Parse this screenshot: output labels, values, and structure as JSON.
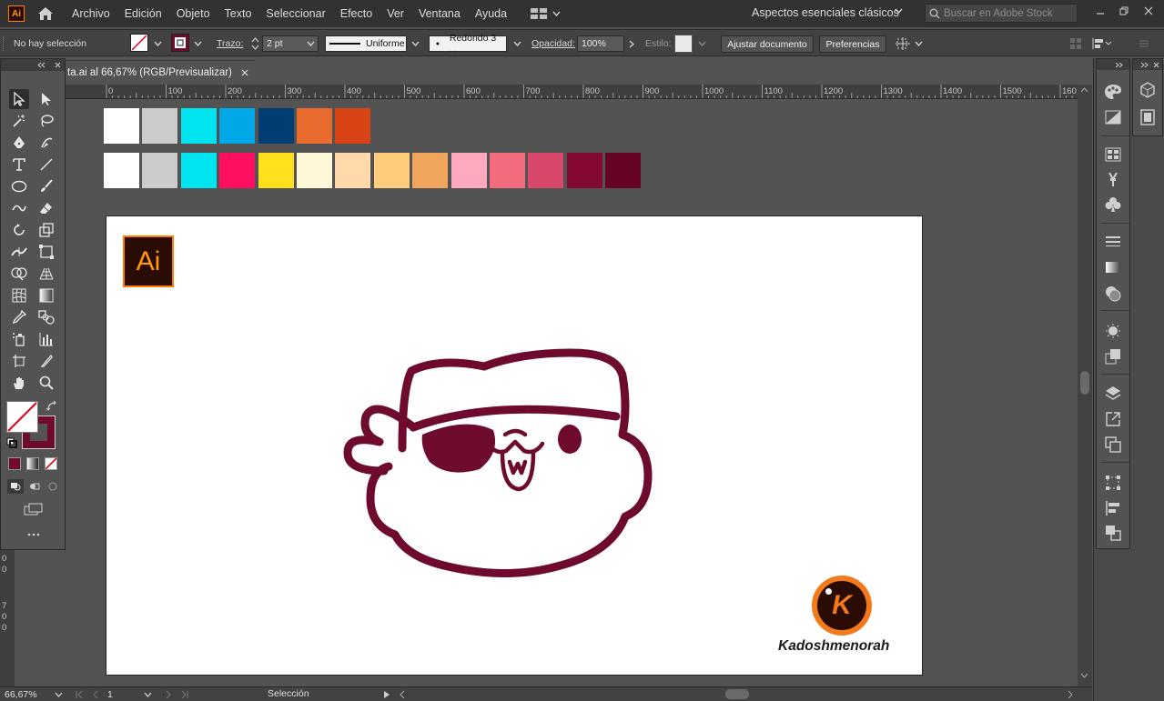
{
  "app": {
    "badge": "Ai"
  },
  "menu": {
    "items": [
      "Archivo",
      "Edición",
      "Objeto",
      "Texto",
      "Seleccionar",
      "Efecto",
      "Ver",
      "Ventana",
      "Ayuda"
    ],
    "workspace": "Aspectos esenciales clásicos",
    "stock_search_placeholder": "Buscar en Adobe Stock"
  },
  "control": {
    "selection_status": "No hay selección",
    "stroke_label": "Trazo:",
    "stroke_weight": "2 pt",
    "stroke_profile": "Uniforme",
    "brush": "Redondo 3 ...",
    "opacity_label": "Opacidad:",
    "opacity_value": "100%",
    "style_label": "Estilo:",
    "fit_document_button": "Ajustar documento",
    "preferences_button": "Preferencias"
  },
  "document": {
    "tab_title": "ta.ai al 66,67% (RGB/Previsualizar)",
    "ruler_labels": [
      "0",
      "100",
      "200",
      "300",
      "400",
      "500",
      "600",
      "700",
      "800",
      "900",
      "1000",
      "1100",
      "1200",
      "1300",
      "1400",
      "1500",
      "160"
    ],
    "vertical_ruler_labels": [
      "0",
      "0",
      "7",
      "0",
      "0"
    ]
  },
  "status": {
    "zoom": "66,67%",
    "artboard_number": "1",
    "tool_name": "Selección"
  },
  "swatches": {
    "row1": [
      "#ffffff",
      "#cccccc",
      "#00e5ef",
      "#00a8e8",
      "#003d73",
      "#ea6b2e",
      "#d84315"
    ],
    "row2": [
      "#ffffff",
      "#cccccc",
      "#00e5ef",
      "#ff0f5f",
      "#ffe01c",
      "#fff8d8",
      "#ffd9ab",
      "#ffcc7c",
      "#f0a55d",
      "#ffa9be",
      "#f26c7e",
      "#d9486a",
      "#850a33",
      "#660223"
    ]
  },
  "artwork": {
    "ai_logo_text": "Ai",
    "watermark_letter": "K",
    "watermark_text": "Kadoshmenorah",
    "stroke_color": "#6d0a2e"
  },
  "colors": {
    "fill": "none",
    "stroke": "#6d0a2e",
    "brand_orange": "#ff7c00"
  }
}
